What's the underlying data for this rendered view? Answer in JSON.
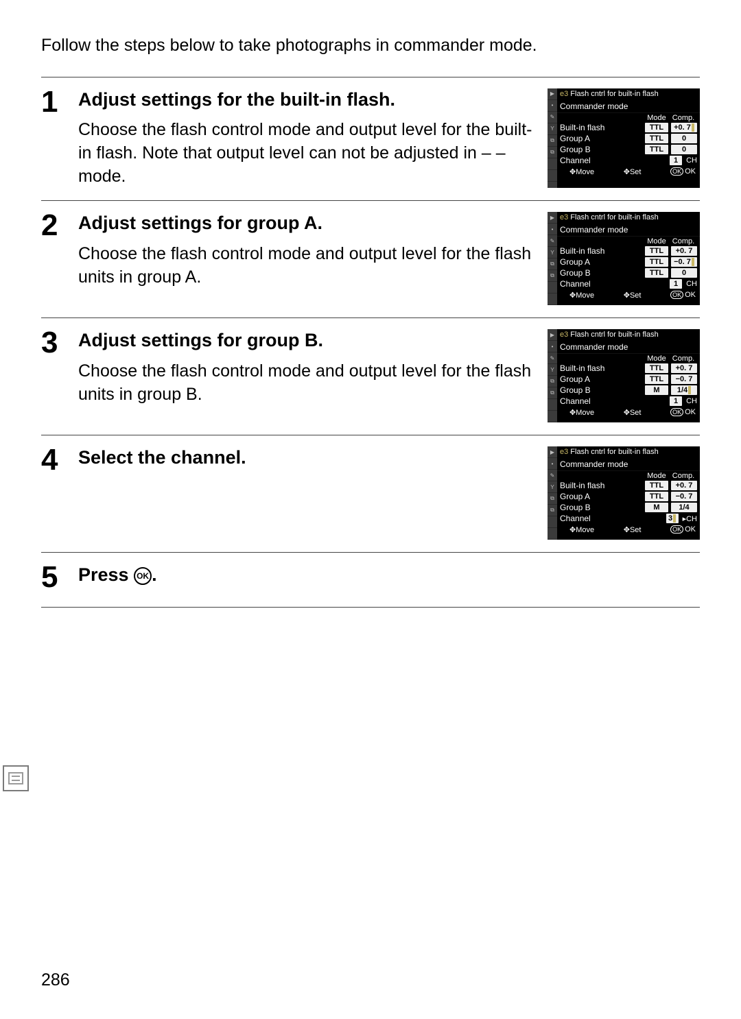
{
  "intro": "Follow the steps below to take photographs in commander mode.",
  "page_number": "286",
  "ok_label": "OK",
  "steps": [
    {
      "num": "1",
      "title": "Adjust settings for the built-in flash.",
      "desc": "Choose the flash control mode and output level for the built-in flash.  Note that output level can not be adjusted in – – mode.",
      "lcd": {
        "title_pre": "e3",
        "title": "Flash cntrl for built-in flash",
        "subtitle": "Commander mode",
        "mode_h": "Mode",
        "comp_h": "Comp.",
        "rows": [
          {
            "label": "Built-in flash",
            "mode": "TTL",
            "comp": "+0. 7",
            "hl": true
          },
          {
            "label": "Group A",
            "mode": "TTL",
            "comp": "0"
          },
          {
            "label": "Group B",
            "mode": "TTL",
            "comp": "0"
          }
        ],
        "channel_label": "Channel",
        "channel_val": "1",
        "channel_suffix": "CH",
        "foot_move": "Move",
        "foot_set": "Set",
        "foot_ok": "OK"
      }
    },
    {
      "num": "2",
      "title": "Adjust settings for group A.",
      "desc": "Choose the flash control mode and output level for the flash units in group A.",
      "lcd": {
        "title_pre": "e3",
        "title": "Flash cntrl for built-in flash",
        "subtitle": "Commander mode",
        "mode_h": "Mode",
        "comp_h": "Comp.",
        "rows": [
          {
            "label": "Built-in flash",
            "mode": "TTL",
            "comp": "+0. 7"
          },
          {
            "label": "Group A",
            "mode": "TTL",
            "comp": "−0. 7",
            "hl": true
          },
          {
            "label": "Group B",
            "mode": "TTL",
            "comp": "0"
          }
        ],
        "channel_label": "Channel",
        "channel_val": "1",
        "channel_suffix": "CH",
        "foot_move": "Move",
        "foot_set": "Set",
        "foot_ok": "OK"
      }
    },
    {
      "num": "3",
      "title": "Adjust settings for group B.",
      "desc": "Choose the flash control mode and output level for the flash units in group B.",
      "lcd": {
        "title_pre": "e3",
        "title": "Flash cntrl for built-in flash",
        "subtitle": "Commander mode",
        "mode_h": "Mode",
        "comp_h": "Comp.",
        "rows": [
          {
            "label": "Built-in flash",
            "mode": "TTL",
            "comp": "+0. 7"
          },
          {
            "label": "Group A",
            "mode": "TTL",
            "comp": "−0. 7"
          },
          {
            "label": "Group B",
            "mode": "M",
            "comp": "1/4",
            "hl": true
          }
        ],
        "channel_label": "Channel",
        "channel_val": "1",
        "channel_suffix": "CH",
        "foot_move": "Move",
        "foot_set": "Set",
        "foot_ok": "OK"
      }
    },
    {
      "num": "4",
      "title": "Select the channel.",
      "desc": "",
      "lcd": {
        "title_pre": "e3",
        "title": "Flash cntrl for built-in flash",
        "subtitle": "Commander mode",
        "mode_h": "Mode",
        "comp_h": "Comp.",
        "rows": [
          {
            "label": "Built-in flash",
            "mode": "TTL",
            "comp": "+0. 7"
          },
          {
            "label": "Group A",
            "mode": "TTL",
            "comp": "−0. 7"
          },
          {
            "label": "Group B",
            "mode": "M",
            "comp": "1/4"
          }
        ],
        "channel_label": "Channel",
        "channel_val": "3",
        "channel_suffix": "CH",
        "channel_hl": true,
        "foot_move": "Move",
        "foot_set": "Set",
        "foot_ok": "OK"
      }
    },
    {
      "num": "5",
      "title_pre": "Press ",
      "title_post": ".",
      "ok_icon": true
    }
  ]
}
